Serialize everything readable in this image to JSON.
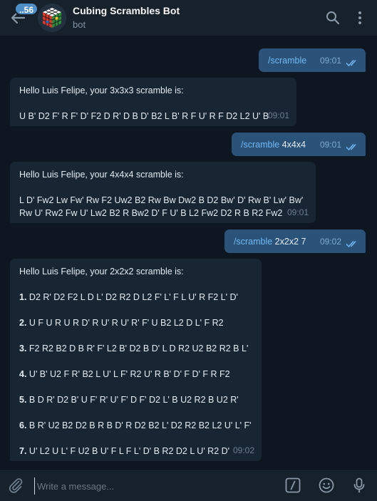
{
  "header": {
    "unread_count": "..56",
    "title": "Cubing Scrambles Bot",
    "subtitle": "bot"
  },
  "messages": {
    "m1": {
      "command": "/scramble",
      "args": "",
      "time": "09:01"
    },
    "m2": {
      "greeting": "Hello Luis Felipe, your 3x3x3 scramble is:",
      "scramble": "U B' D2 F' R F' D' F2 D R' D B D' B2 L B' R F U' R F D2 L2 U' B",
      "time": "09:01"
    },
    "m3": {
      "command": "/scramble",
      "args": " 4x4x4",
      "time": "09:01"
    },
    "m4": {
      "greeting": "Hello Luis Felipe, your 4x4x4 scramble is:",
      "scramble_line1": "L D' Fw2 Lw Fw' Rw F2 Uw2 B2 Rw Bw Dw2 B D2 Bw' D' Rw B' Lw' Bw'",
      "scramble_line2": "Rw U' Rw2 Fw U' Lw2 B2 R Bw2 D' F U' B L2 Fw2 D2 R B R2 Fw2",
      "time": "09:01"
    },
    "m5": {
      "command": "/scramble",
      "args": " 2x2x2 7",
      "time": "09:02"
    },
    "m6": {
      "greeting": "Hello Luis Felipe, your 2x2x2 scramble is:",
      "items": [
        {
          "num": "1.",
          "text": " D2 R' D2 F2 L D L' D2 R2 D L2 F' L' F L U' R F2 L' D'"
        },
        {
          "num": "2.",
          "text": " U F U R U R D' R U' R U' R' F' U B2 L2 D L' F R2"
        },
        {
          "num": "3.",
          "text": " F2 R2 B2 D B R' F' L2 B' D2 B D' L D R2 U2 B2 R2 B L'"
        },
        {
          "num": "4.",
          "text": " U' B' U2 F R' B2 L U' L F' R2 U' R B' D' F D' F R F2"
        },
        {
          "num": "5.",
          "text": " B D R' D2 B' U F' R' U' F' D F' D2 L' B U2 R2 B U2 R'"
        },
        {
          "num": "6.",
          "text": " B R' U2 B2 D2 B R B D' R D2 B2 L' D2 R2 B2 L2 U' L' F'"
        },
        {
          "num": "7.",
          "text": " U' L2 U L' F U2 B U' F L F L' D' B R2 D2 L U' R2 D'"
        }
      ],
      "time": "09:02"
    }
  },
  "composer": {
    "placeholder": "Write a message..."
  },
  "colors": {
    "background": "#0e1621",
    "outgoing_bubble": "#2b5278",
    "incoming_bubble": "#182533",
    "command_link": "#71b9f5",
    "header": "#17212b"
  },
  "icons": [
    "back-arrow-icon",
    "search-icon",
    "more-vertical-icon",
    "attach-icon",
    "bot-command-icon",
    "emoji-icon",
    "microphone-icon",
    "double-check-icon"
  ]
}
